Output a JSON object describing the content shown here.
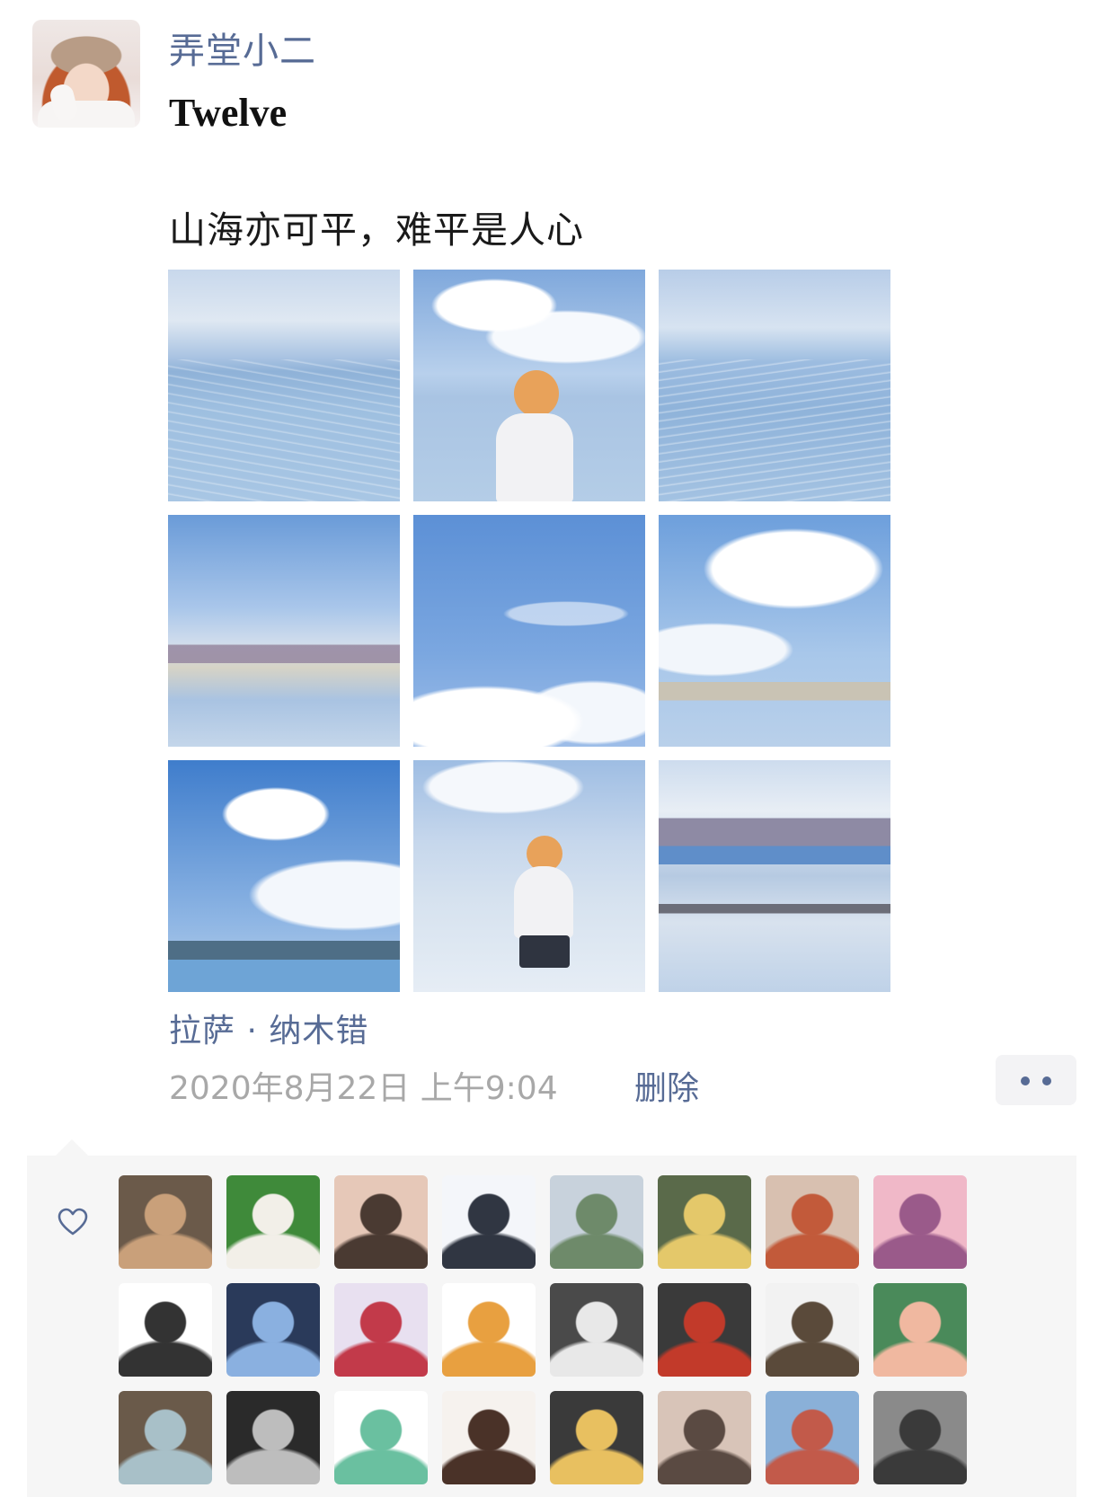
{
  "post": {
    "username": "弄堂小二",
    "subtitle": "Twelve",
    "text": "山海亦可平，难平是人心",
    "location": "拉萨 · 纳木错",
    "timestamp": "2020年8月22日 上午9:04",
    "delete_label": "删除"
  },
  "photos": [
    "lake-sparkling-water",
    "girl-by-lake",
    "lake-sparkling-water-2",
    "mountains-lake-reflection",
    "blue-sky-clouds",
    "clouds-over-lake",
    "sky-mountains-lake",
    "girl-posing-by-lake",
    "lake-horizon-reflection"
  ],
  "likes": {
    "icon": "heart-icon",
    "avatars": [
      {
        "name": "liker-1",
        "colors": [
          "#6b5a4a",
          "#c9a07a"
        ]
      },
      {
        "name": "liker-2",
        "colors": [
          "#3f8a3a",
          "#f2efe8"
        ]
      },
      {
        "name": "liker-3",
        "colors": [
          "#e6c8b8",
          "#4a3a32"
        ]
      },
      {
        "name": "liker-4",
        "colors": [
          "#f4f6fa",
          "#303642"
        ]
      },
      {
        "name": "liker-5",
        "colors": [
          "#c8d2dc",
          "#6e8a6a"
        ]
      },
      {
        "name": "liker-6",
        "colors": [
          "#5a6a4a",
          "#e4c86a"
        ]
      },
      {
        "name": "liker-7",
        "colors": [
          "#d8c0b0",
          "#c25a3a"
        ]
      },
      {
        "name": "liker-8",
        "colors": [
          "#f0b8c8",
          "#9a5a8a"
        ]
      },
      {
        "name": "liker-9",
        "colors": [
          "#ffffff",
          "#333333"
        ]
      },
      {
        "name": "liker-10",
        "colors": [
          "#2a3a5a",
          "#8ab0e0"
        ]
      },
      {
        "name": "liker-11",
        "colors": [
          "#e8e0f0",
          "#c23a4a"
        ]
      },
      {
        "name": "liker-12",
        "colors": [
          "#ffffff",
          "#e8a040"
        ]
      },
      {
        "name": "liker-13",
        "colors": [
          "#4a4a4a",
          "#e8e8e8"
        ]
      },
      {
        "name": "liker-14",
        "colors": [
          "#3a3a3a",
          "#c23a2a"
        ]
      },
      {
        "name": "liker-15",
        "colors": [
          "#f2f2f2",
          "#5a4a3a"
        ]
      },
      {
        "name": "liker-16",
        "colors": [
          "#4a8a5a",
          "#f0b8a0"
        ]
      },
      {
        "name": "liker-17",
        "colors": [
          "#6a5a4a",
          "#a8c0c8"
        ]
      },
      {
        "name": "liker-18",
        "colors": [
          "#2a2a2a",
          "#bdbdbd"
        ]
      },
      {
        "name": "liker-19",
        "colors": [
          "#ffffff",
          "#6ac0a0"
        ]
      },
      {
        "name": "liker-20",
        "colors": [
          "#f6f2ee",
          "#4a3228"
        ]
      },
      {
        "name": "liker-21",
        "colors": [
          "#3a3a3a",
          "#e8c060"
        ]
      },
      {
        "name": "liker-22",
        "colors": [
          "#d8c4b8",
          "#5a4a42"
        ]
      },
      {
        "name": "liker-23",
        "colors": [
          "#8ab0d8",
          "#c25a4a"
        ]
      },
      {
        "name": "liker-24",
        "colors": [
          "#8a8a8a",
          "#3a3a3a"
        ]
      }
    ]
  }
}
